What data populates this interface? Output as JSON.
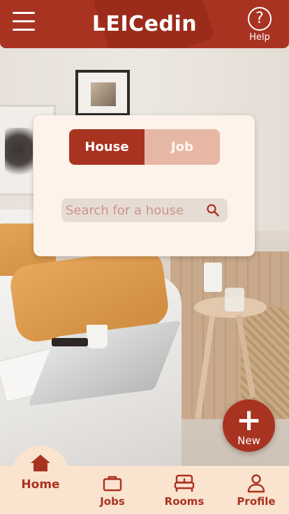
{
  "header": {
    "title": "LEICedin",
    "help_label": "Help",
    "help_glyph": "?"
  },
  "search_card": {
    "toggle": [
      {
        "label": "House",
        "active": true
      },
      {
        "label": "Job",
        "active": false
      }
    ],
    "search": {
      "placeholder": "Search for a house",
      "value": ""
    }
  },
  "fab": {
    "glyph": "+",
    "label": "New"
  },
  "bottom_nav": {
    "items": [
      {
        "label": "Home",
        "icon": "home-icon",
        "active": true
      },
      {
        "label": "Jobs",
        "icon": "briefcase-icon",
        "active": false
      },
      {
        "label": "Rooms",
        "icon": "bed-icon",
        "active": false
      },
      {
        "label": "Profile",
        "icon": "person-icon",
        "active": false
      }
    ]
  },
  "colors": {
    "primary": "#a93321",
    "card_bg": "#fef3ea",
    "nav_bg": "#fae3cf",
    "toggle_inactive": "#e7b7a6",
    "search_bg": "#e7dcd3"
  }
}
